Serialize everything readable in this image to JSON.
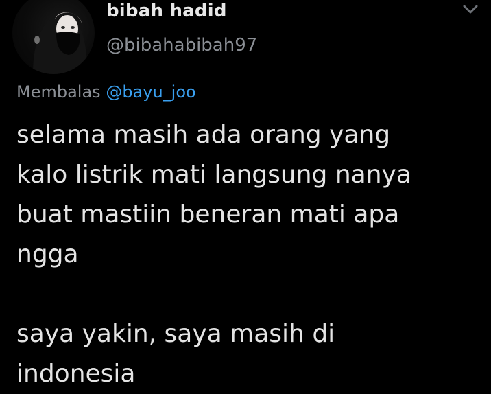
{
  "author": {
    "display_name": "bibah hadid",
    "handle": "@bibahabibah97"
  },
  "reply": {
    "prefix": "Membalas",
    "mention": "@bayu_joo"
  },
  "tweet": {
    "paragraph_1": [
      "selama masih ada orang yang",
      "kalo listrik mati langsung nanya",
      "buat mastiin beneran mati apa",
      "ngga"
    ],
    "paragraph_2": [
      "saya yakin, saya masih di",
      "indonesia"
    ]
  },
  "icons": {
    "menu": "chevron-down-icon",
    "avatar": "profile-photo"
  },
  "colors": {
    "background": "#000000",
    "text": "#e4e4e4",
    "muted": "#8b8f95",
    "link": "#3aa0f0"
  }
}
